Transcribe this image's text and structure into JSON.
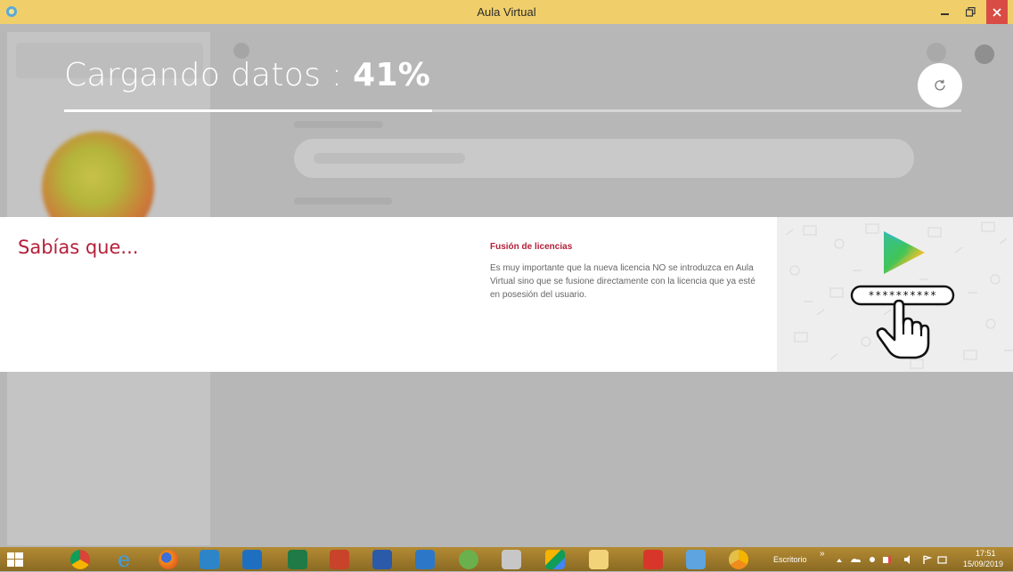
{
  "window": {
    "title": "Aula Virtual"
  },
  "loading": {
    "label": "Cargando datos : ",
    "percent_text": "41%",
    "progress": 0.41
  },
  "tip": {
    "heading": "Sabías que...",
    "title": "Fusión de licencias",
    "body": "Es muy importante que la nueva licencia NO se introduzca en Aula Virtual sino que se fusione directamente con la licencia que ya esté en posesión del usuario.",
    "illustration_password": "**********"
  },
  "taskbar": {
    "apps": [
      "start-icon",
      "chrome-icon",
      "ie-icon",
      "firefox-icon",
      "media-player-icon",
      "outlook-icon",
      "excel-icon",
      "powerpoint-icon",
      "word-icon",
      "onedrive-icon",
      "utorrent-icon",
      "snipping-tool-icon",
      "google-drive-icon",
      "file-explorer-icon",
      "acrobat-icon",
      "control-panel-icon",
      "chrome-canary-icon"
    ],
    "desktop_label": "Escritorio",
    "time": "17:51",
    "date": "15/09/2019"
  },
  "colors": {
    "accent": "#b41f3a",
    "titlebar": "#f0cf6b",
    "close": "#d94b45"
  }
}
